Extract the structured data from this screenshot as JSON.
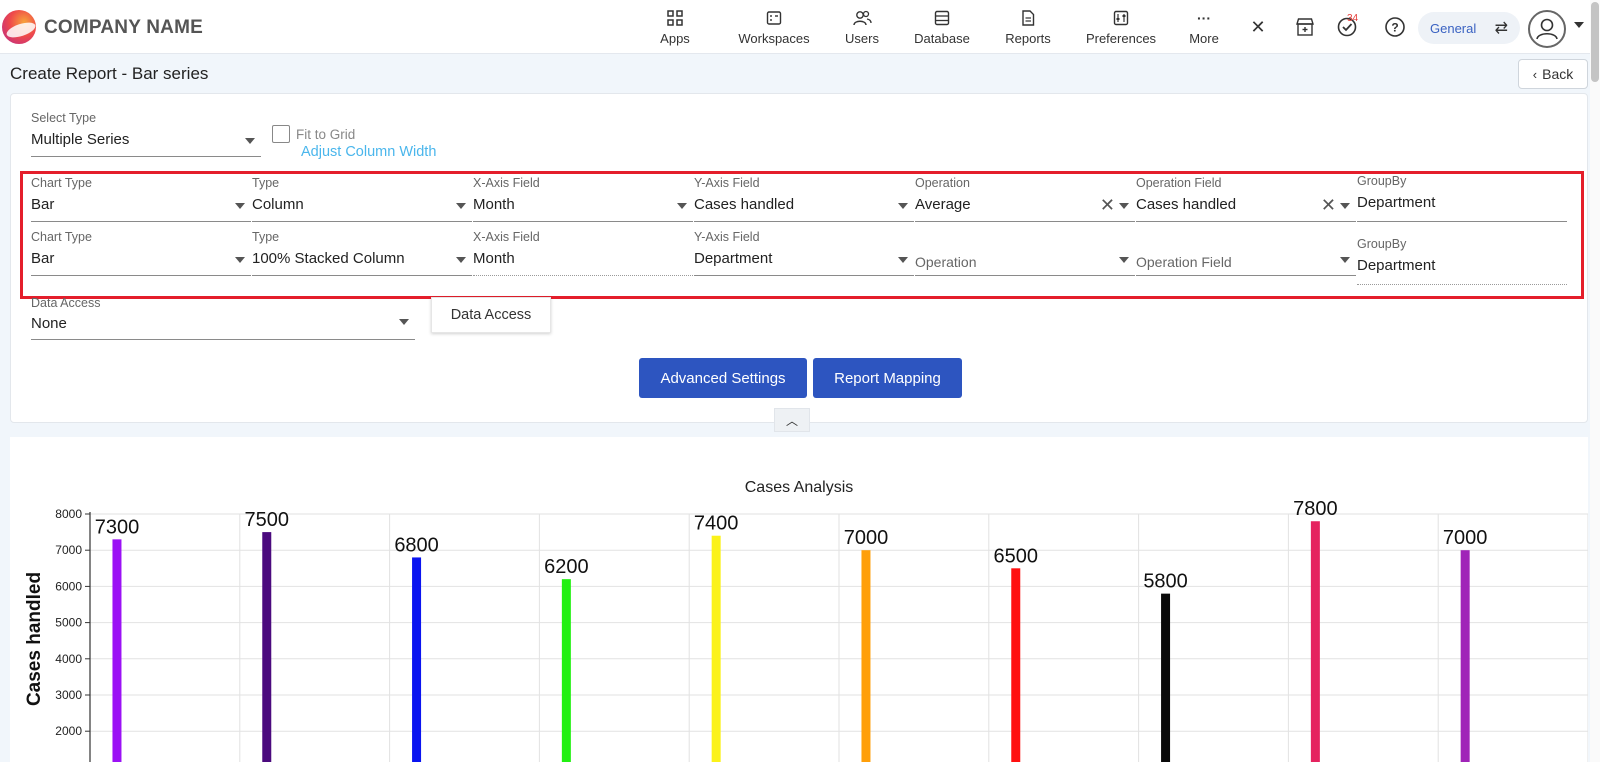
{
  "header": {
    "company_name": "COMPANY NAME",
    "nav": [
      {
        "label": "Apps",
        "icon": "apps-grid-icon"
      },
      {
        "label": "Workspaces",
        "icon": "workspaces-icon"
      },
      {
        "label": "Users",
        "icon": "users-icon"
      },
      {
        "label": "Database",
        "icon": "database-icon"
      },
      {
        "label": "Reports",
        "icon": "reports-icon"
      },
      {
        "label": "Preferences",
        "icon": "preferences-icon"
      },
      {
        "label": "More",
        "icon": "more-dots-icon"
      }
    ],
    "task_badge": "34",
    "workspace_switch": "General"
  },
  "page": {
    "title": "Create Report - Bar series",
    "back_label": "Back"
  },
  "form": {
    "select_type": {
      "label": "Select Type",
      "value": "Multiple Series"
    },
    "fit_to_grid": {
      "label": "Fit to Grid",
      "checked": false
    },
    "adjust_column_width": "Adjust Column Width",
    "series": [
      {
        "chart_type": {
          "label": "Chart Type",
          "value": "Bar"
        },
        "type": {
          "label": "Type",
          "value": "Column"
        },
        "x_axis": {
          "label": "X-Axis Field",
          "value": "Month"
        },
        "y_axis": {
          "label": "Y-Axis Field",
          "value": "Cases handled"
        },
        "operation": {
          "label": "Operation",
          "value": "Average"
        },
        "operation_field": {
          "label": "Operation Field",
          "value": "Cases handled"
        },
        "group_by": {
          "label": "GroupBy",
          "value": "Department"
        }
      },
      {
        "chart_type": {
          "label": "Chart Type",
          "value": "Bar"
        },
        "type": {
          "label": "Type",
          "value": "100% Stacked Column"
        },
        "x_axis": {
          "label": "X-Axis Field",
          "value": "Month"
        },
        "y_axis": {
          "label": "Y-Axis Field",
          "value": "Department"
        },
        "operation": {
          "placeholder": "Operation"
        },
        "operation_field": {
          "placeholder": "Operation Field"
        },
        "group_by": {
          "label": "GroupBy",
          "value": "Department"
        }
      }
    ],
    "data_access": {
      "label": "Data Access",
      "value": "None"
    },
    "data_access_button": "Data Access",
    "advanced_settings": "Advanced Settings",
    "report_mapping": "Report Mapping"
  },
  "colors": {
    "primary_button": "#2d55c0",
    "highlight_border": "#e41e2b",
    "link": "#4ab6ec"
  },
  "chart_data": {
    "type": "bar",
    "title": "Cases Analysis",
    "ylabel": "Cases handled",
    "xlabel": "",
    "yticks": [
      2000,
      3000,
      4000,
      5000,
      6000,
      7000,
      8000
    ],
    "ylim": [
      2000,
      8000
    ],
    "grid": true,
    "values": [
      7300,
      7500,
      6800,
      6200,
      7400,
      7000,
      6500,
      5800,
      7800,
      7000
    ],
    "colors": [
      "#9b11f5",
      "#4b0a7e",
      "#0a14f0",
      "#22f012",
      "#fbf21a",
      "#ff9f0a",
      "#ff1010",
      "#0a0a0a",
      "#e5235f",
      "#a024b8"
    ]
  }
}
